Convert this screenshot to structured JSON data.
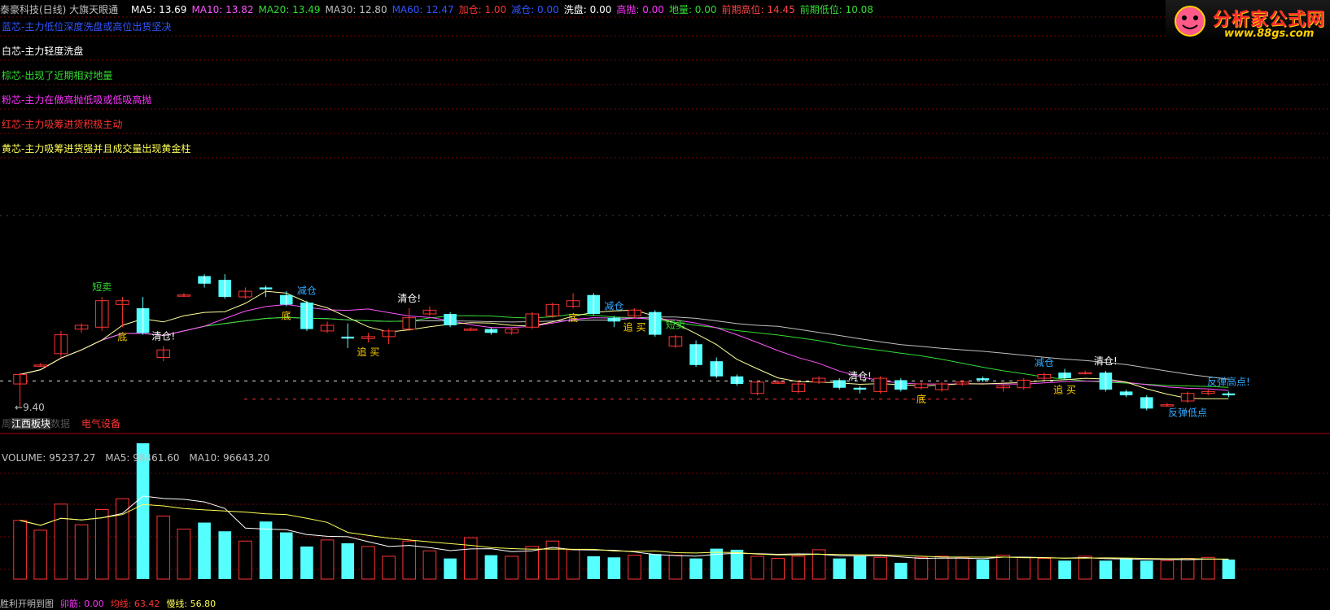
{
  "header": {
    "title": "泰豪科技(日线) 大旗天眼通",
    "indicators": [
      {
        "label": "MA5: 13.69",
        "color": "#ffffff"
      },
      {
        "label": "MA10: 13.82",
        "color": "#ff55ff"
      },
      {
        "label": "MA20: 13.49",
        "color": "#33dd33"
      },
      {
        "label": "MA30: 12.80",
        "color": "#c0c0c0"
      },
      {
        "label": "MA60: 12.47",
        "color": "#3355ff"
      },
      {
        "label": "加仓: 1.00",
        "color": "#ff3333"
      },
      {
        "label": "减仓: 0.00",
        "color": "#3355ff"
      },
      {
        "label": "洗盘: 0.00",
        "color": "#ffffff"
      },
      {
        "label": "高抛: 0.00",
        "color": "#ff33ff"
      },
      {
        "label": "地量: 0.00",
        "color": "#33dd33"
      },
      {
        "label": "前期高位: 14.45",
        "color": "#ff4444"
      },
      {
        "label": "前期低位: 10.08",
        "color": "#33dd33"
      }
    ]
  },
  "logo": {
    "title": "分析家公式网",
    "url": "www.88gs.com"
  },
  "legend": [
    {
      "text": "蓝芯-主力低位深度洗盘或高位出货坚决",
      "color": "#3355ff"
    },
    {
      "text": "白芯-主力轻度洗盘",
      "color": "#ffffff"
    },
    {
      "text": "棕芯-出现了近期相对地量",
      "color": "#33dd33"
    },
    {
      "text": "粉芯-主力在做高抛低吸或低吸高抛",
      "color": "#ff33ff"
    },
    {
      "text": "红芯-主力吸筹进货积极主动",
      "color": "#ff3333"
    },
    {
      "text": "黄芯-主力吸筹进货强并且成交量出现黄金柱",
      "color": "#ffff55"
    }
  ],
  "labels": {
    "low_price": "9.40",
    "sector_a": "江西板块",
    "sector_a_suffix": "数据",
    "sector_b": "电气设备",
    "sector_a_prefix": "周"
  },
  "volume_header": {
    "volume": "VOLUME: 95237.27",
    "ma5": "MA5: 98461.60",
    "ma10": "MA10: 96643.20"
  },
  "bottom_row": [
    {
      "text": "胜利开明到图",
      "color": "#c0c0c0"
    },
    {
      "text": "卯筋: 0.00",
      "color": "#ff33ff"
    },
    {
      "text": "均线: 63.42",
      "color": "#ff3333"
    },
    {
      "text": "慢线: 56.80",
      "color": "#ffff55"
    }
  ],
  "chart_data": {
    "type": "candlestick",
    "count": 60,
    "price_range": [
      9.4,
      14.45
    ],
    "candles": [
      {
        "open": 10.0,
        "close": 10.25,
        "high": 10.3,
        "low": 9.4
      },
      {
        "open": 10.5,
        "close": 10.5,
        "high": 10.55,
        "low": 10.45
      },
      {
        "open": 10.8,
        "close": 11.3,
        "high": 11.4,
        "low": 10.7
      },
      {
        "open": 11.45,
        "close": 11.55,
        "high": 11.6,
        "low": 11.35
      },
      {
        "open": 11.5,
        "close": 12.2,
        "high": 12.3,
        "low": 11.4
      },
      {
        "open": 12.1,
        "close": 12.2,
        "high": 12.3,
        "low": 11.5
      },
      {
        "open": 12.0,
        "close": 11.35,
        "high": 12.3,
        "low": 11.3
      },
      {
        "open": 10.7,
        "close": 10.9,
        "high": 11.0,
        "low": 10.6
      },
      {
        "open": 12.35,
        "close": 12.35,
        "high": 12.4,
        "low": 12.3
      },
      {
        "open": 12.85,
        "close": 12.65,
        "high": 12.9,
        "low": 12.55
      },
      {
        "open": 12.75,
        "close": 12.3,
        "high": 12.9,
        "low": 12.25
      },
      {
        "open": 12.3,
        "close": 12.45,
        "high": 12.55,
        "low": 12.25
      },
      {
        "open": 12.55,
        "close": 12.5,
        "high": 12.6,
        "low": 12.3
      },
      {
        "open": 12.35,
        "close": 12.1,
        "high": 12.45,
        "low": 12.05
      },
      {
        "open": 12.15,
        "close": 11.45,
        "high": 12.2,
        "low": 11.4
      },
      {
        "open": 11.4,
        "close": 11.55,
        "high": 11.65,
        "low": 11.35
      },
      {
        "open": 11.25,
        "close": 11.2,
        "high": 11.6,
        "low": 10.95
      },
      {
        "open": 11.2,
        "close": 11.25,
        "high": 11.35,
        "low": 11.1
      },
      {
        "open": 11.25,
        "close": 11.4,
        "high": 11.45,
        "low": 11.05
      },
      {
        "open": 11.45,
        "close": 11.75,
        "high": 12.0,
        "low": 11.4
      },
      {
        "open": 11.85,
        "close": 11.95,
        "high": 12.05,
        "low": 11.8
      },
      {
        "open": 11.85,
        "close": 11.55,
        "high": 11.9,
        "low": 11.5
      },
      {
        "open": 11.45,
        "close": 11.45,
        "high": 11.5,
        "low": 11.4
      },
      {
        "open": 11.45,
        "close": 11.35,
        "high": 11.5,
        "low": 11.3
      },
      {
        "open": 11.35,
        "close": 11.45,
        "high": 11.5,
        "low": 11.3
      },
      {
        "open": 11.5,
        "close": 11.85,
        "high": 11.9,
        "low": 11.45
      },
      {
        "open": 11.8,
        "close": 12.1,
        "high": 12.15,
        "low": 11.75
      },
      {
        "open": 12.05,
        "close": 12.2,
        "high": 12.4,
        "low": 12.0
      },
      {
        "open": 12.35,
        "close": 11.85,
        "high": 12.4,
        "low": 11.8
      },
      {
        "open": 11.75,
        "close": 11.65,
        "high": 11.8,
        "low": 11.5
      },
      {
        "open": 11.8,
        "close": 11.95,
        "high": 12.0,
        "low": 11.75
      },
      {
        "open": 11.9,
        "close": 11.3,
        "high": 11.95,
        "low": 11.25
      },
      {
        "open": 11.0,
        "close": 11.25,
        "high": 11.3,
        "low": 10.95
      },
      {
        "open": 11.05,
        "close": 10.5,
        "high": 11.15,
        "low": 10.45
      },
      {
        "open": 10.6,
        "close": 10.2,
        "high": 10.7,
        "low": 10.15
      },
      {
        "open": 10.2,
        "close": 10.0,
        "high": 10.25,
        "low": 9.95
      },
      {
        "open": 9.75,
        "close": 10.05,
        "high": 10.1,
        "low": 9.7
      },
      {
        "open": 10.05,
        "close": 10.05,
        "high": 10.1,
        "low": 10.0
      },
      {
        "open": 9.8,
        "close": 10.0,
        "high": 10.1,
        "low": 9.75
      },
      {
        "open": 10.05,
        "close": 10.15,
        "high": 10.2,
        "low": 10.0
      },
      {
        "open": 10.1,
        "close": 9.9,
        "high": 10.15,
        "low": 9.85
      },
      {
        "open": 9.9,
        "close": 9.85,
        "high": 9.95,
        "low": 9.75
      },
      {
        "open": 9.8,
        "close": 10.15,
        "high": 10.2,
        "low": 9.75
      },
      {
        "open": 10.1,
        "close": 9.85,
        "high": 10.15,
        "low": 9.8
      },
      {
        "open": 9.9,
        "close": 10.0,
        "high": 10.1,
        "low": 9.85
      },
      {
        "open": 9.85,
        "close": 10.0,
        "high": 10.05,
        "low": 9.8
      },
      {
        "open": 10.0,
        "close": 10.05,
        "high": 10.1,
        "low": 9.95
      },
      {
        "open": 10.15,
        "close": 10.1,
        "high": 10.2,
        "low": 10.05
      },
      {
        "open": 9.9,
        "close": 9.95,
        "high": 10.0,
        "low": 9.8
      },
      {
        "open": 9.9,
        "close": 10.1,
        "high": 10.15,
        "low": 9.85
      },
      {
        "open": 10.15,
        "close": 10.25,
        "high": 10.3,
        "low": 10.1
      },
      {
        "open": 10.3,
        "close": 10.15,
        "high": 10.4,
        "low": 10.1
      },
      {
        "open": 10.3,
        "close": 10.3,
        "high": 10.35,
        "low": 10.25
      },
      {
        "open": 10.3,
        "close": 9.85,
        "high": 10.35,
        "low": 9.8
      },
      {
        "open": 9.8,
        "close": 9.7,
        "high": 9.85,
        "low": 9.65
      },
      {
        "open": 9.65,
        "close": 9.35,
        "high": 9.7,
        "low": 9.3
      },
      {
        "open": 9.45,
        "close": 9.45,
        "high": 9.5,
        "low": 9.4
      },
      {
        "open": 9.55,
        "close": 9.75,
        "high": 9.8,
        "low": 9.5
      },
      {
        "open": 9.75,
        "close": 9.8,
        "high": 9.85,
        "low": 9.7
      },
      {
        "open": 9.75,
        "close": 9.7,
        "high": 9.8,
        "low": 9.65
      }
    ],
    "volume": [
      54000,
      45000,
      69000,
      50000,
      64000,
      74000,
      125000,
      58000,
      46000,
      52000,
      44000,
      35000,
      53000,
      43000,
      30000,
      36000,
      33000,
      30000,
      21000,
      35000,
      26000,
      19000,
      38000,
      22000,
      21000,
      30000,
      35000,
      27000,
      21000,
      20000,
      22000,
      23000,
      22000,
      19000,
      28000,
      27000,
      21000,
      19000,
      21000,
      27000,
      19000,
      21000,
      20000,
      15000,
      20000,
      21000,
      20000,
      18000,
      22000,
      20000,
      19000,
      17000,
      21000,
      17000,
      19000,
      17000,
      17000,
      19000,
      20000,
      18000
    ],
    "annotations": [
      {
        "text": "短卖",
        "color": "#33dd33",
        "candle": 6
      },
      {
        "text": "清仓!",
        "color": "#ffffff",
        "candle": 11
      },
      {
        "text": "底",
        "color": "#ffd000",
        "candle": 8
      },
      {
        "text": "减仓",
        "color": "#33aaff",
        "candle": 21
      },
      {
        "text": "底",
        "color": "#ffd000",
        "candle": 19
      },
      {
        "text": "追 买",
        "color": "#ffd000",
        "candle": 25
      },
      {
        "text": "清仓!",
        "color": "#ffffff",
        "candle": 29
      },
      {
        "text": "减仓",
        "color": "#33aaff",
        "candle": 44
      },
      {
        "text": "短卖",
        "color": "#33dd33",
        "candle": 48
      },
      {
        "text": "底",
        "color": "#ffd000",
        "candle": 40
      },
      {
        "text": "追 买",
        "color": "#ffd000",
        "candle": 46
      },
      {
        "text": "清仓!",
        "color": "#ffffff",
        "candle": 62
      },
      {
        "text": "底",
        "color": "#ffd000",
        "candle": 66
      },
      {
        "text": "减仓",
        "color": "#33aaff",
        "candle": 75
      },
      {
        "text": "追 买",
        "color": "#ffd000",
        "candle": 77
      },
      {
        "text": "清仓!",
        "color": "#ffffff",
        "candle": 80
      },
      {
        "text": "反弹高点!",
        "color": "#33aaff",
        "candle": 89
      },
      {
        "text": "反弹低点",
        "color": "#33aaff",
        "candle": 86
      }
    ]
  }
}
